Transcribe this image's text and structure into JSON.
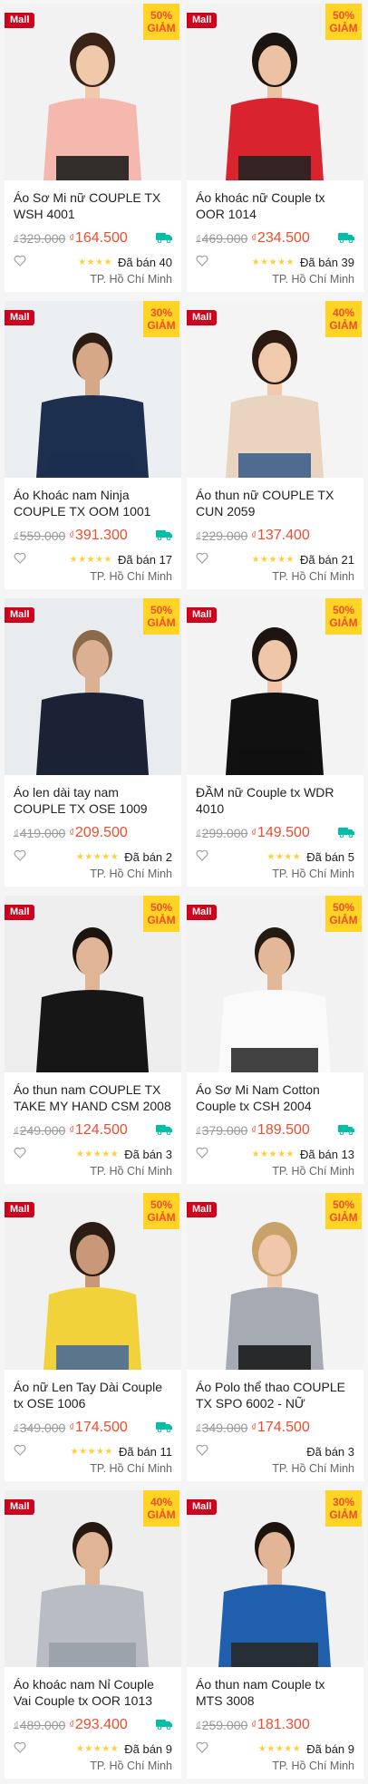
{
  "badges": {
    "mall": "Mall",
    "sale_suffix": "GIẢM",
    "sold_prefix": "Đã bán"
  },
  "colors": {
    "accent": "#ee4d2d",
    "mall_bg": "#d0011b",
    "sale_bg": "#ffd424",
    "star": "#ffce3d"
  },
  "products": [
    {
      "title": "Áo Sơ Mi nữ COUPLE TX WSH 4001",
      "old_price": "329.000",
      "new_price": "164.500",
      "discount": "50%",
      "sold": "Đã bán 40",
      "location": "TP. Hồ Chí Minh",
      "mall": true,
      "freeship": true,
      "rating_stars": 4,
      "icon": "blouse-woman-pink"
    },
    {
      "title": "Áo khoác nữ Couple tx OOR 1014",
      "old_price": "469.000",
      "new_price": "234.500",
      "discount": "50%",
      "sold": "Đã bán 39",
      "location": "TP. Hồ Chí Minh",
      "mall": true,
      "freeship": true,
      "rating_stars": 5,
      "icon": "jacket-woman-red"
    },
    {
      "title": "Áo Khoác nam Ninja COUPLE TX OOM 1001",
      "old_price": "559.000",
      "new_price": "391.300",
      "discount": "30%",
      "sold": "Đã bán 17",
      "location": "TP. Hồ Chí Minh",
      "mall": true,
      "freeship": true,
      "rating_stars": 5,
      "icon": "hoodie-man-navy"
    },
    {
      "title": "Áo thun nữ COUPLE TX CUN 2059",
      "old_price": "229.000",
      "new_price": "137.400",
      "discount": "40%",
      "sold": "Đã bán 21",
      "location": "TP. Hồ Chí Minh",
      "mall": true,
      "freeship": false,
      "rating_stars": 5,
      "icon": "tshirt-woman-beige"
    },
    {
      "title": "Áo len dài tay nam COUPLE TX OSE 1009",
      "old_price": "419.000",
      "new_price": "209.500",
      "discount": "50%",
      "sold": "Đã bán 2",
      "location": "TP. Hồ Chí Minh",
      "mall": true,
      "freeship": false,
      "rating_stars": 5,
      "icon": "sweater-man-navy"
    },
    {
      "title": "ĐẦM nữ Couple tx WDR 4010",
      "old_price": "299.000",
      "new_price": "149.500",
      "discount": "50%",
      "sold": "Đã bán 5",
      "location": "TP. Hồ Chí Minh",
      "mall": true,
      "freeship": true,
      "rating_stars": 4,
      "icon": "dress-woman-black"
    },
    {
      "title": "Áo thun nam COUPLE TX TAKE MY HAND CSM 2008",
      "old_price": "249.000",
      "new_price": "124.500",
      "discount": "50%",
      "sold": "Đã bán 3",
      "location": "TP. Hồ Chí Minh",
      "mall": true,
      "freeship": true,
      "rating_stars": 5,
      "icon": "tshirt-couple-black"
    },
    {
      "title": "Áo Sơ Mi Nam Cotton Couple tx CSH 2004",
      "old_price": "379.000",
      "new_price": "189.500",
      "discount": "50%",
      "sold": "Đã bán 13",
      "location": "TP. Hồ Chí Minh",
      "mall": true,
      "freeship": true,
      "rating_stars": 5,
      "icon": "shirt-man-white"
    },
    {
      "title": "Áo nữ Len Tay Dài Couple tx OSE 1006",
      "old_price": "349.000",
      "new_price": "174.500",
      "discount": "50%",
      "sold": "Đã bán 11",
      "location": "TP. Hồ Chí Minh",
      "mall": true,
      "freeship": true,
      "rating_stars": 5,
      "icon": "sweater-woman-yellow"
    },
    {
      "title": "Áo Polo thể thao COUPLE TX SPO 6002 - NỮ",
      "old_price": "349.000",
      "new_price": "174.500",
      "discount": "50%",
      "sold": "Đã bán 3",
      "location": "TP. Hồ Chí Minh",
      "mall": true,
      "freeship": false,
      "rating_stars": 0,
      "icon": "polo-woman-striped"
    },
    {
      "title": "Áo khoác nam Nỉ Couple Vai Couple tx OOR 1013",
      "old_price": "489.000",
      "new_price": "293.400",
      "discount": "40%",
      "sold": "Đã bán 9",
      "location": "TP. Hồ Chí Minh",
      "mall": true,
      "freeship": true,
      "rating_stars": 5,
      "icon": "hoodie-man-grey"
    },
    {
      "title": "Áo thun nam Couple tx MTS 3008",
      "old_price": "259.000",
      "new_price": "181.300",
      "discount": "30%",
      "sold": "Đã bán 9",
      "location": "TP. Hồ Chí Minh",
      "mall": true,
      "freeship": false,
      "rating_stars": 5,
      "icon": "tshirt-man-blue"
    }
  ]
}
